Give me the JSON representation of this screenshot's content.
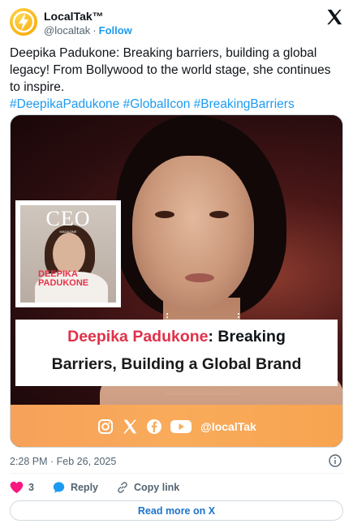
{
  "header": {
    "display_name": "LocalTak™",
    "handle": "@localtak",
    "separator": "·",
    "follow_label": "Follow",
    "avatar_icon": "lightning-bolt-icon",
    "platform_icon": "x-logo-icon"
  },
  "tweet": {
    "text": "Deepika Padukone: Breaking barriers, building a global legacy!  From Bollywood to the world stage, she continues to inspire.",
    "hashtags": "#DeepikaPadukone #GlobalIcon #BreakingBarriers"
  },
  "media": {
    "magazine_title": "CEO",
    "magazine_subtitle": "MAGAZINE",
    "magazine_name_line1": "DEEPIKA",
    "magazine_name_line2": "PADUKONE",
    "banner_highlight": "Deepika Padukone",
    "banner_line1_rest": ": Breaking",
    "banner_line2": "Barriers, Building a Global Brand",
    "social_icons": [
      "instagram-icon",
      "x-icon",
      "facebook-icon",
      "youtube-icon"
    ],
    "social_handle": "@localTak"
  },
  "meta": {
    "timestamp": "2:28 PM · Feb 26, 2025"
  },
  "actions": {
    "like_count": "3",
    "reply_label": "Reply",
    "copy_link_label": "Copy link"
  },
  "read_more_label": "Read more on X",
  "colors": {
    "link_blue": "#1d9bf0",
    "like_pink": "#f91880",
    "banner_red": "#e0314a",
    "social_bar_orange": "#f9ab5a"
  }
}
